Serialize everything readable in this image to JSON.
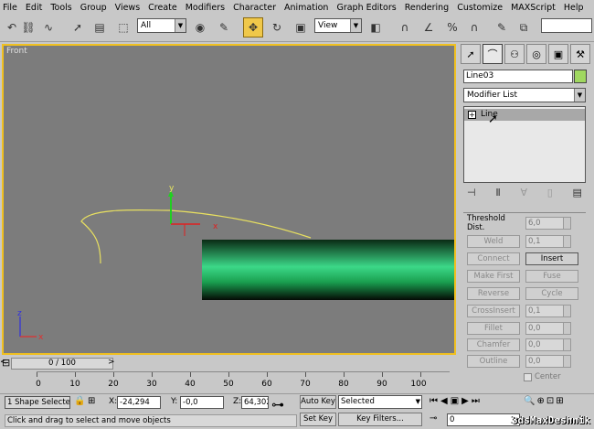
{
  "menu": [
    "File",
    "Edit",
    "Tools",
    "Group",
    "Views",
    "Create",
    "Modifiers",
    "Character",
    "Animation",
    "Graph Editors",
    "Rendering",
    "Customize",
    "MAXScript",
    "Help"
  ],
  "toolbar": {
    "selection_filter": "All",
    "ref_coord": "View"
  },
  "viewport": {
    "label": "Front",
    "axis_y": "y",
    "axis_x": "x",
    "corner_z": "z",
    "corner_x": "x"
  },
  "panel": {
    "object_name": "Line03",
    "object_color": "#a0d860",
    "modifier_list": "Modifier List",
    "stack_item": "Line",
    "stack_plus": "+"
  },
  "rollout": {
    "threshold_label": "Threshold Dist.",
    "threshold_value": "6,0",
    "weld": "Weld",
    "weld_value": "0,1",
    "connect": "Connect",
    "insert": "Insert",
    "make_first": "Make First",
    "fuse": "Fuse",
    "reverse": "Reverse",
    "cycle": "Cycle",
    "crossinsert": "CrossInsert",
    "crossinsert_value": "0,1",
    "fillet": "Fillet",
    "fillet_value": "0,0",
    "chamfer": "Chamfer",
    "chamfer_value": "0,0",
    "outline": "Outline",
    "outline_value": "0,0",
    "center": "Center"
  },
  "timeline": {
    "slider": "0 / 100",
    "ticks": [
      "0",
      "10",
      "20",
      "30",
      "40",
      "50",
      "60",
      "70",
      "80",
      "90",
      "100"
    ]
  },
  "status": {
    "selection": "1 Shape Selecte",
    "x_label": "X:",
    "x_value": "-24,294",
    "y_label": "Y:",
    "y_value": "-0,0",
    "z_label": "Z:",
    "z_value": "64,302",
    "auto_key": "Auto Key",
    "selected": "Selected",
    "set_key": "Set Key",
    "key_filters": "Key Filters...",
    "prompt": "Click and drag to select and move objects",
    "frame": "0"
  },
  "watermark": "3dsMaxDeshnik"
}
